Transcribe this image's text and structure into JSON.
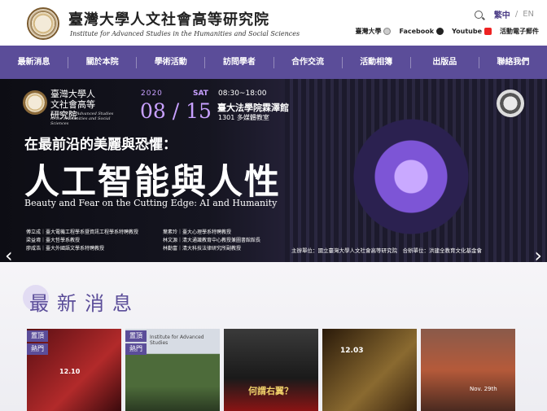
{
  "header": {
    "logo_cn": "臺灣大學人文社會高等研究院",
    "logo_en": "Institute for Advanced Studies in the Humanities and Social Sciences",
    "lang_active": "繁中",
    "lang_sep": "/",
    "lang_other": "EN",
    "links": {
      "ntu": "臺灣大學",
      "facebook": "Facebook",
      "youtube": "Youtube",
      "newsletter": "活動電子郵件"
    }
  },
  "nav": [
    "最新消息",
    "關於本院",
    "學術活動",
    "訪問學者",
    "合作交流",
    "活動相簿",
    "出版品",
    "聯絡我們"
  ],
  "banner": {
    "logo_cn": "臺灣大學人文社會高等研究院",
    "logo_en": "Institute for Advanced Studies in the Humanities and Social Sciences",
    "year": "2020",
    "date": "08 / 15",
    "weekday": "SAT",
    "time": "08:30~18:00",
    "venue": "臺大法學院霖澤館",
    "room": "1301 多媒體教室",
    "subtitle": "在最前沿的美麗與恐懼：",
    "title": "人工智能與人性",
    "title_en": "Beauty and Fear on the Cutting Edge: AI and Humanity",
    "speakers_left": [
      "傅立成｜臺大電機工程學系暨資訊工程學系特聘教授",
      "梁益堉｜臺大哲學系教授",
      "廖咸浩｜臺大外國語文學系特聘教授"
    ],
    "speakers_right": [
      "葉素玲｜臺大心理學系特聘教授",
      "林文源｜清大通識教育中心教授兼圖書館館長",
      "林勤富｜清大科技法律研究所副教授"
    ],
    "organizers": "主辦單位：國立臺灣大學人文社會高等研究院　合辦單位：洪建全教育文化基金會"
  },
  "news": {
    "title": "最新消息",
    "cards": [
      {
        "pin": "置頂",
        "hot": "熱門",
        "text": "12.10"
      },
      {
        "pin": "置頂",
        "hot": "熱門",
        "text": "Institute for Advanced Studies"
      },
      {
        "pin": "",
        "hot": "",
        "text": "何謂右翼？"
      },
      {
        "pin": "",
        "hot": "",
        "text": "12.03"
      },
      {
        "pin": "",
        "hot": "",
        "text": "Nov. 29th"
      }
    ]
  },
  "colors": {
    "brand_purple": "#5b4d99",
    "banner_accent": "#c8a0ff"
  }
}
